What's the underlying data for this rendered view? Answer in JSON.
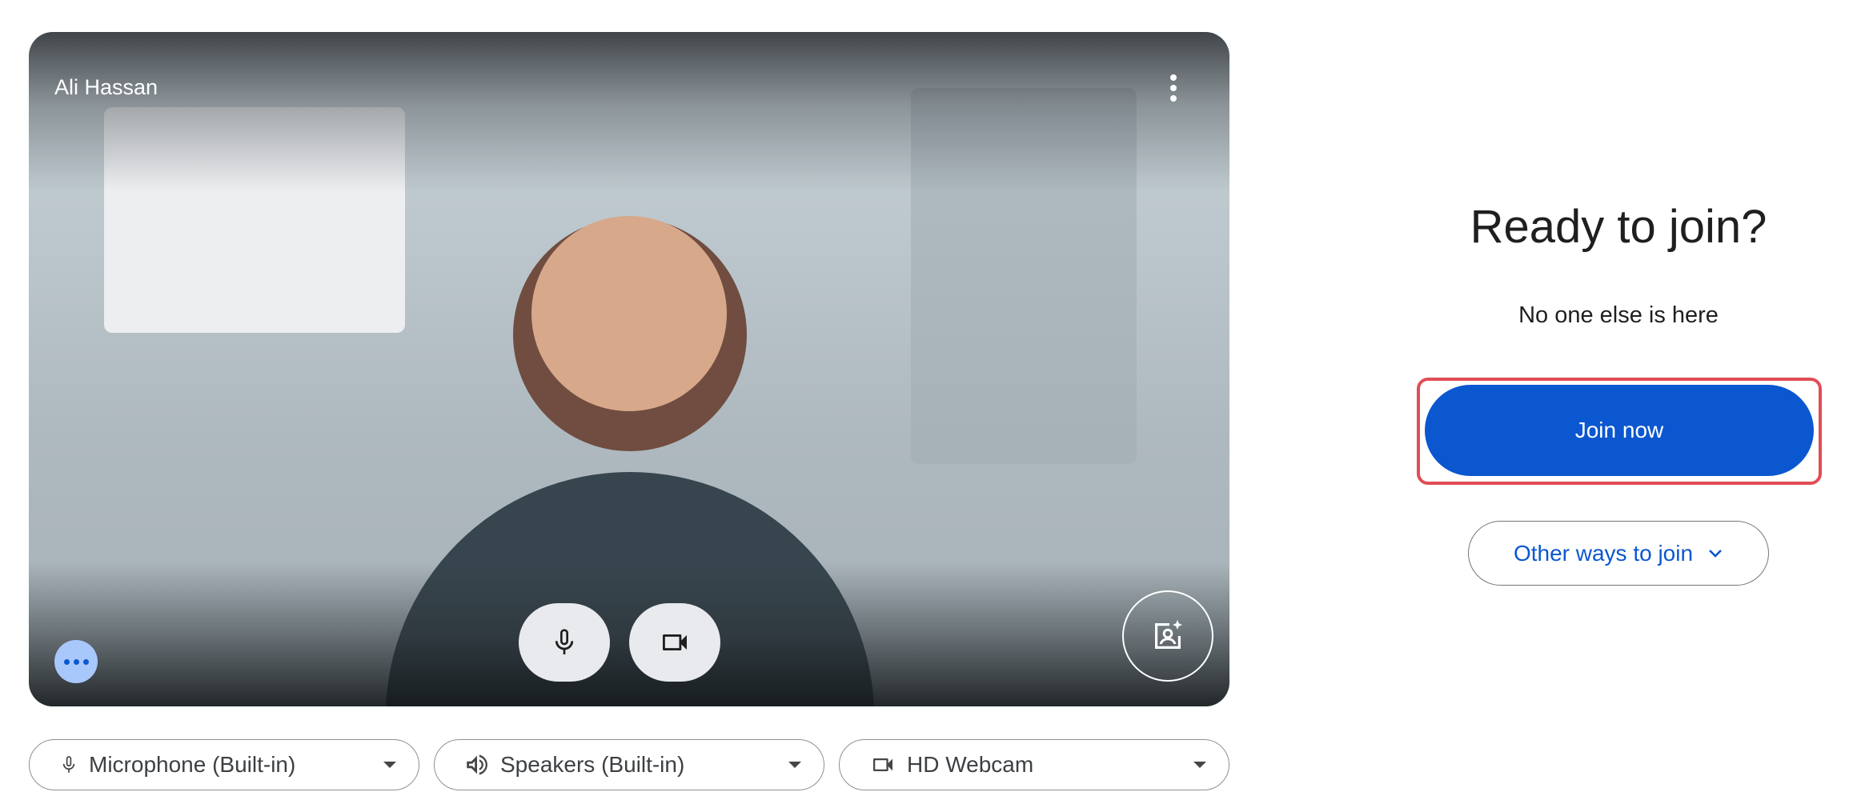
{
  "preview": {
    "participant_name": "Ali Hassan",
    "camera_on": true,
    "mic_on": true
  },
  "devices": {
    "microphone": {
      "label": "Microphone (Built-in)"
    },
    "speakers": {
      "label": "Speakers (Built-in)"
    },
    "camera": {
      "label": "HD Webcam"
    }
  },
  "join_panel": {
    "title": "Ready to join?",
    "status": "No one else is here",
    "join_label": "Join now",
    "other_ways_label": "Other ways to join"
  },
  "colors": {
    "primary": "#0b57d0",
    "highlight": "#e14d55",
    "more_button": "#a8c7fa"
  }
}
